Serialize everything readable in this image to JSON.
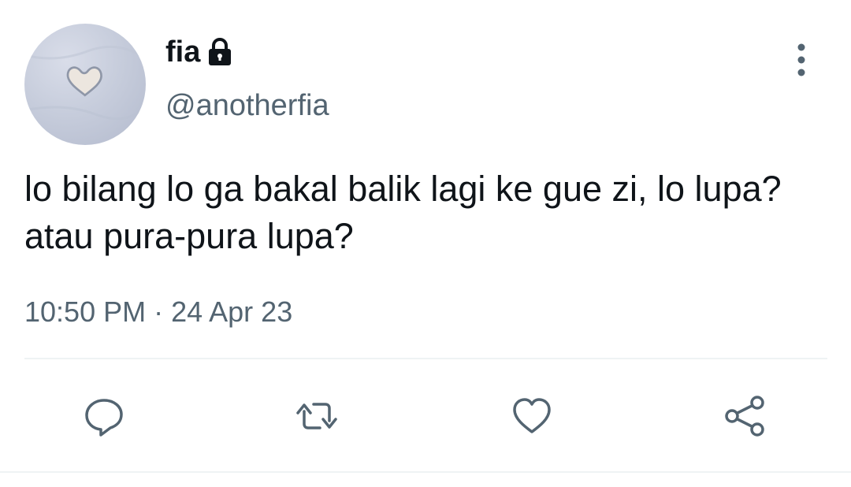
{
  "user": {
    "display_name": "fia",
    "handle": "@anotherfia",
    "protected_icon": "lock-icon",
    "avatar_icon": "heart-icon"
  },
  "tweet": {
    "text": "lo bilang lo ga bakal balik lagi ke gue zi, lo lupa? atau pura-pura lupa?",
    "time": "10:50 PM",
    "separator": "·",
    "date": "24 Apr 23"
  },
  "actions": {
    "reply_icon": "reply-icon",
    "retweet_icon": "retweet-icon",
    "like_icon": "heart-icon",
    "share_icon": "share-icon",
    "more_icon": "more-vertical-icon"
  },
  "colors": {
    "text_primary": "#0f1419",
    "text_secondary": "#536471",
    "icon": "#536471",
    "divider": "#eff3f4"
  }
}
